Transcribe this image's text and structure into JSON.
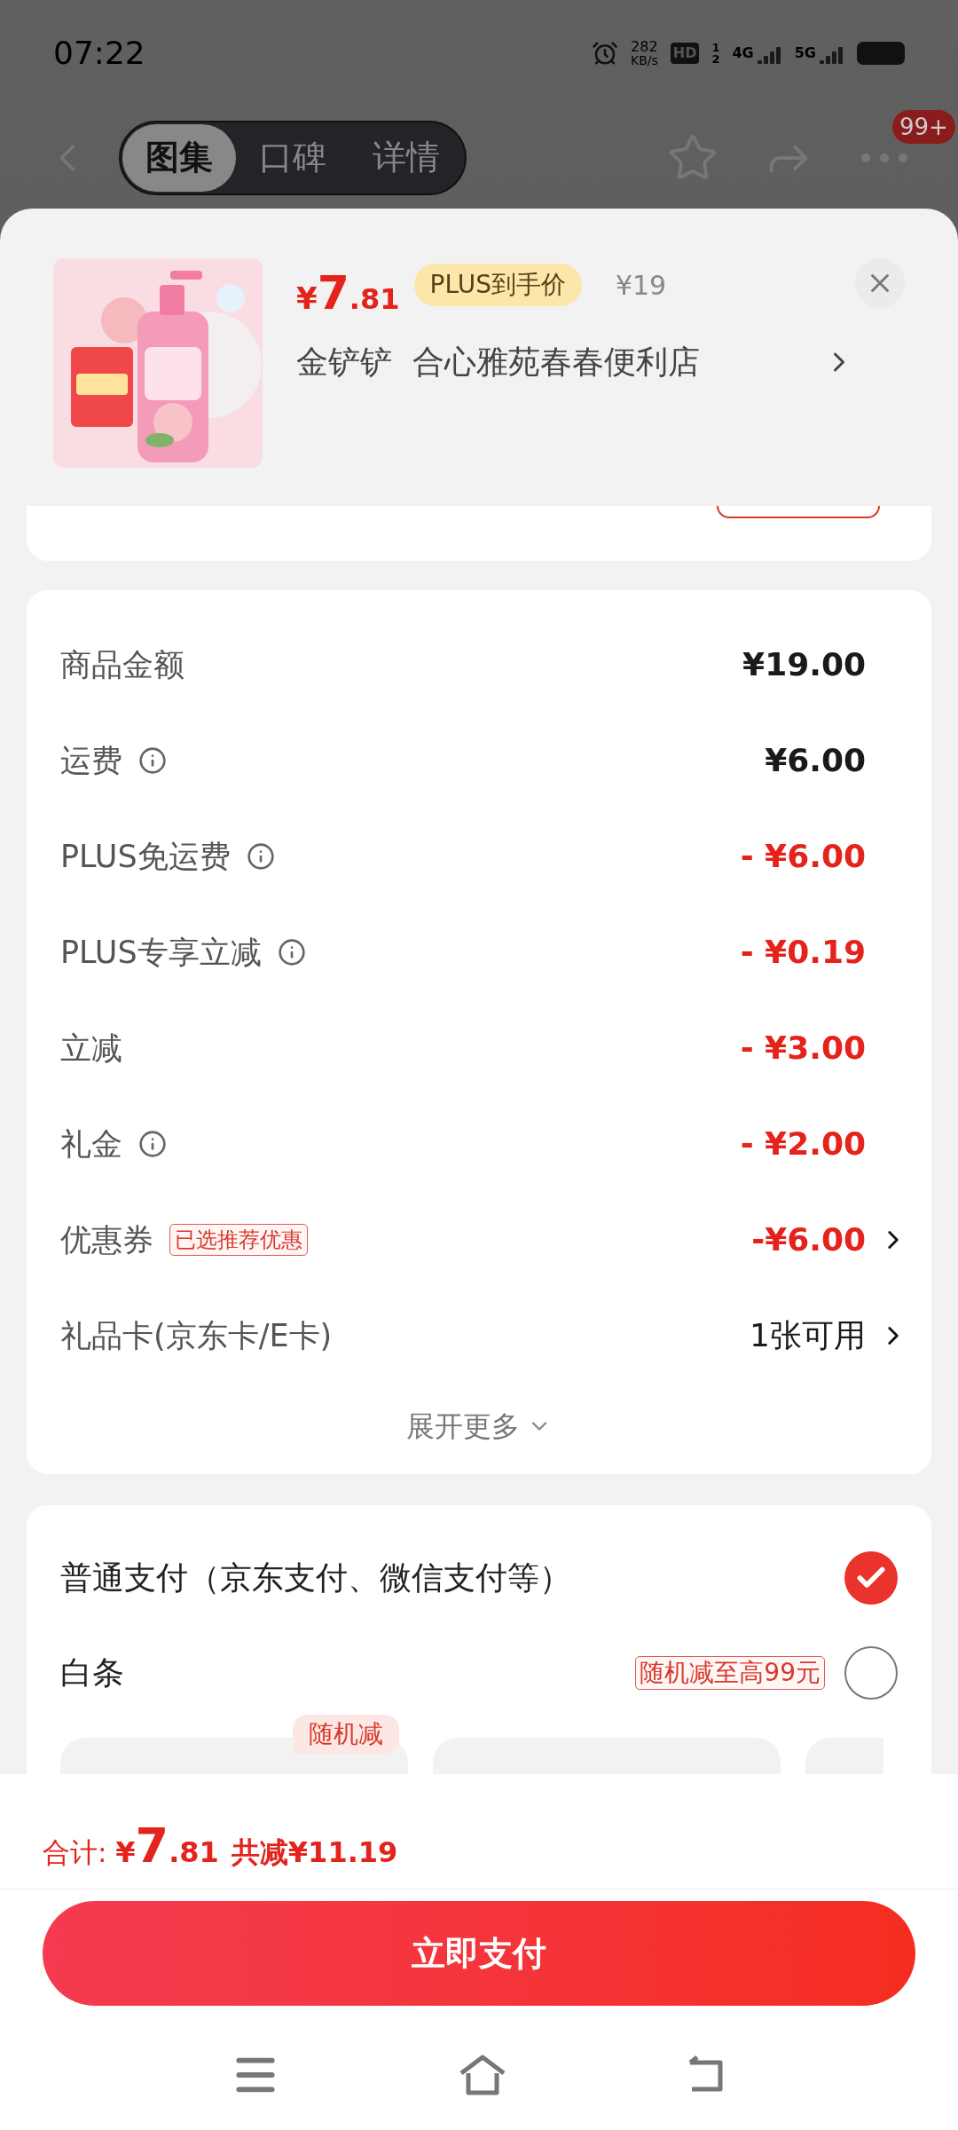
{
  "status_bar": {
    "time": "07:22",
    "speed_value": "282",
    "speed_unit": "KB/s",
    "hd": "HD",
    "sim_labels": [
      "1",
      "2"
    ],
    "networks": [
      "4G",
      "5G"
    ]
  },
  "nav": {
    "tabs": [
      {
        "label": "图集",
        "selected": true
      },
      {
        "label": "口碑",
        "selected": false
      },
      {
        "label": "详情",
        "selected": false
      }
    ],
    "badge": "99+"
  },
  "product": {
    "kind": "picture",
    "currency": "¥",
    "price_int": "7",
    "price_dec": ".81",
    "price_tag": "PLUS到手价",
    "original_price": "¥19",
    "store": "金铲铲  合心雅苑春春便利店"
  },
  "summary": {
    "rows": [
      {
        "label": "商品金额",
        "info": false,
        "value": "¥19.00",
        "kind": "plain",
        "chevron": false
      },
      {
        "label": "运费",
        "info": true,
        "value": "¥6.00",
        "kind": "plain",
        "chevron": false
      },
      {
        "label": "PLUS免运费",
        "info": true,
        "value": "- ¥6.00",
        "kind": "discount",
        "chevron": false
      },
      {
        "label": "PLUS专享立减",
        "info": true,
        "value": "- ¥0.19",
        "kind": "discount",
        "chevron": false
      },
      {
        "label": "立减",
        "info": false,
        "value": "- ¥3.00",
        "kind": "discount",
        "chevron": false
      },
      {
        "label": "礼金",
        "info": true,
        "value": "- ¥2.00",
        "kind": "discount",
        "chevron": false
      },
      {
        "label": "优惠券",
        "tag": "已选推荐优惠",
        "info": false,
        "value": "-¥6.00",
        "kind": "discount",
        "chevron": true
      },
      {
        "label": "礼品卡(京东卡/E卡)",
        "info": false,
        "value": "1张可用",
        "kind": "plain",
        "chevron": true
      }
    ],
    "expand": "展开更多"
  },
  "payment": {
    "methods": [
      {
        "label": "普通支付（京东支付、微信支付等）",
        "selected": true
      },
      {
        "label": "白条",
        "tag": "随机减至高99元",
        "selected": false
      }
    ],
    "installment_badge": "随机减"
  },
  "footer": {
    "total_label": "合计: ",
    "currency": "¥",
    "total_int": "7",
    "total_dec": ".81",
    "saved": "共减¥11.19",
    "pay_button": "立即支付"
  }
}
